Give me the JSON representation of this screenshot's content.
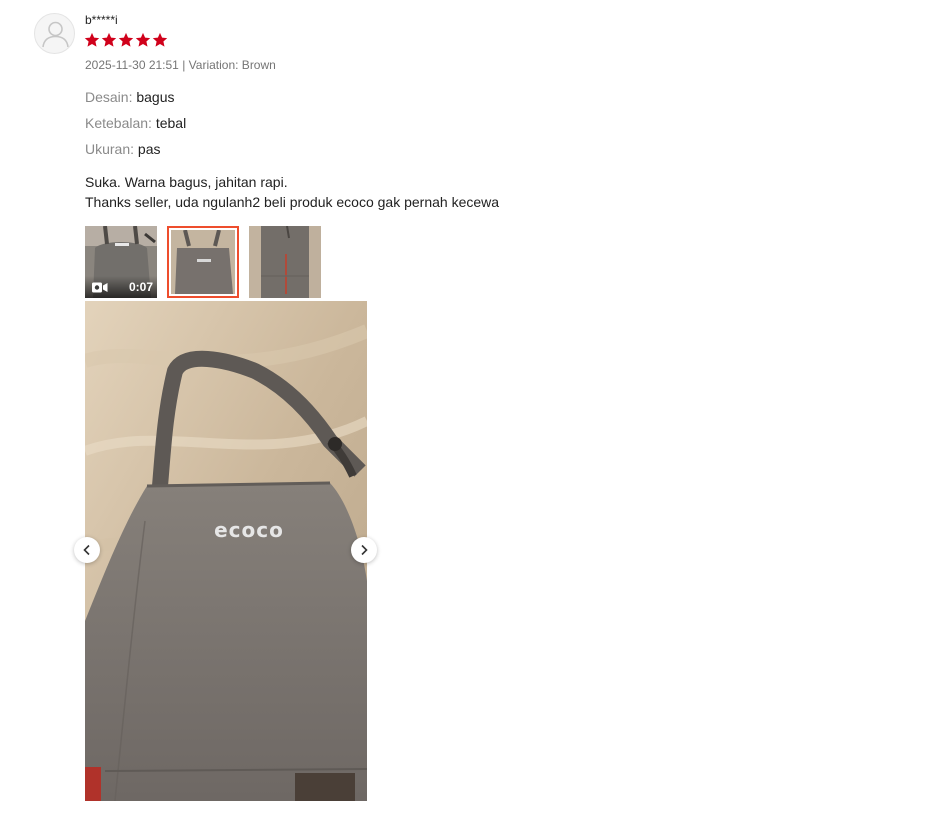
{
  "review": {
    "username": "b*****i",
    "rating": 5,
    "date": "2025-11-30 21:51",
    "variation": "Variation: Brown",
    "separator": "|",
    "attributes": [
      {
        "label": "Desain:",
        "value": "bagus"
      },
      {
        "label": "Ketebalan:",
        "value": "tebal"
      },
      {
        "label": "Ukuran:",
        "value": "pas"
      }
    ],
    "comment_lines": [
      "Suka. Warna bagus, jahitan rapi.",
      "Thanks seller, uda ngulanh2 beli produk ecoco gak pernah kecewa"
    ],
    "media": {
      "video_duration": "0:07",
      "selected_index": 1,
      "product_logo_text": "ecoco"
    }
  },
  "colors": {
    "star": "#d0011b",
    "selected_border": "#ee4d2d",
    "muted_text": "#757575",
    "label_text": "#8a8a8a"
  },
  "icons": {
    "avatar": "user-silhouette-icon",
    "star": "star-icon",
    "video": "video-camera-icon",
    "prev": "chevron-left-icon",
    "next": "chevron-right-icon"
  }
}
